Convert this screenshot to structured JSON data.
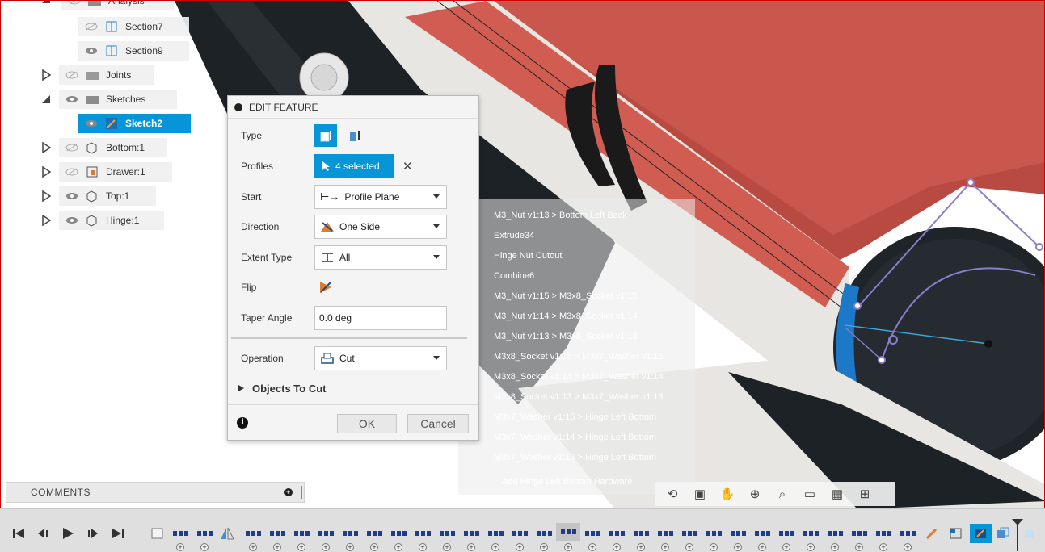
{
  "browser": {
    "analysis_label": "Analysis",
    "items": [
      {
        "label": "Section7"
      },
      {
        "label": "Section9"
      },
      {
        "label": "Joints"
      },
      {
        "label": "Sketches"
      },
      {
        "label": "Sketch2"
      },
      {
        "label": "Bottom:1"
      },
      {
        "label": "Drawer:1"
      },
      {
        "label": "Top:1"
      },
      {
        "label": "Hinge:1"
      }
    ]
  },
  "dialog": {
    "title": "EDIT FEATURE",
    "type_label": "Type",
    "profiles_label": "Profiles",
    "profiles_value": "4 selected",
    "start_label": "Start",
    "start_value": "Profile Plane",
    "direction_label": "Direction",
    "direction_value": "One Side",
    "extent_label": "Extent Type",
    "extent_value": "All",
    "flip_label": "Flip",
    "taper_label": "Taper Angle",
    "taper_value": "0.0 deg",
    "operation_label": "Operation",
    "operation_value": "Cut",
    "objects_label": "Objects To Cut",
    "ok_label": "OK",
    "cancel_label": "Cancel"
  },
  "timeline_popup": {
    "items": [
      "M3_Nut v1:13 > Bottom Left Back",
      "Extrude34",
      "Hinge Nut Cutout",
      "Combine6",
      "M3_Nut v1:15 > M3x8_Socket v1:15",
      "M3_Nut v1:14 > M3x8_Socket v1:14",
      "M3_Nut v1:13 > M3x8_Socket v1:13",
      "M3x8_Socket v1:15 > M3x7_Washer v1:15",
      "M3x8_Socket v1:14 > M3x7_Washer v1:14",
      "M3x8_Socket v1:13 > M3x7_Washer v1:13",
      "M3x7_Washer v1:15 > Hinge Left Bottom",
      "M3x7_Washer v1:14 > Hinge Left Bottom",
      "M3x7_Washer v1:13 > Hinge Left Bottom"
    ],
    "footer": "Add Hinge Left Bottom Hardware"
  },
  "comments": {
    "label": "COMMENTS"
  },
  "colors": {
    "accent": "#0696d7",
    "body_red": "#c9574d",
    "dark_part": "#1c2126",
    "hinge_white": "#e7e6e2",
    "sketch_purple": "#8a7dc9",
    "timeline_feature": "#1f3d8c"
  },
  "icons": {
    "eye": "eye-icon",
    "eye_hidden": "eye-slash-icon",
    "folder": "folder-icon",
    "component": "component-icon",
    "section": "section-analysis-icon",
    "sketch": "sketch-icon",
    "extrude": "extrude-icon",
    "cut": "cut-operation-icon",
    "info": "info-icon"
  }
}
